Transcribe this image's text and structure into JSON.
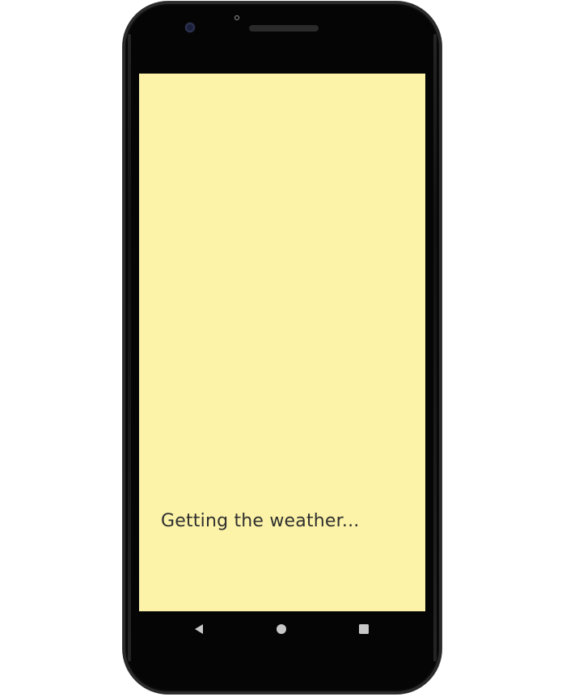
{
  "screen": {
    "background_color": "#fcf3a8",
    "status_message": "Getting the weather..."
  },
  "navigation_bar": {
    "back_icon": "back-triangle-icon",
    "home_icon": "home-circle-icon",
    "recents_icon": "recents-square-icon",
    "icon_color": "#c8c8c8"
  },
  "device": {
    "frame_color": "#050505"
  }
}
